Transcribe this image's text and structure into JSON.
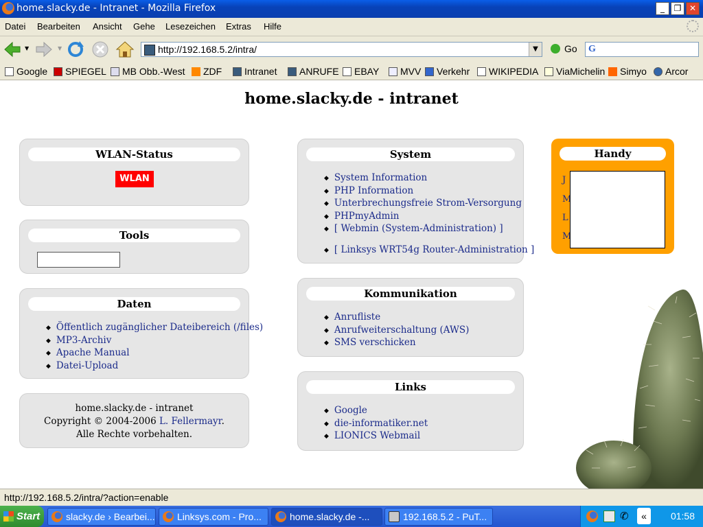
{
  "window": {
    "title": "home.slacky.de - Intranet - Mozilla Firefox",
    "minimize": "_",
    "maximize": "❐",
    "close": "✕"
  },
  "menu": [
    "Datei",
    "Bearbeiten",
    "Ansicht",
    "Gehe",
    "Lesezeichen",
    "Extras",
    "Hilfe"
  ],
  "nav": {
    "url": "http://192.168.5.2/intra/",
    "go_label": "Go",
    "search_value": ""
  },
  "bookmarks": [
    "Google",
    "SPIEGEL",
    "MB Obb.-West",
    "ZDF",
    "Intranet",
    "ANRUFE",
    "EBAY",
    "MVV",
    "Verkehr",
    "WIKIPEDIA",
    "ViaMichelin",
    "Simyo",
    "Arcor"
  ],
  "page": {
    "title": "home.slacky.de - intranet",
    "wlan": {
      "heading": "WLAN-Status",
      "button": "WLAN"
    },
    "tools": {
      "heading": "Tools",
      "input_value": ""
    },
    "daten": {
      "heading": "Daten",
      "items": [
        "Öffentlich zugänglicher Dateibereich (/files)",
        "MP3-Archiv",
        "Apache Manual",
        "Datei-Upload"
      ]
    },
    "footer": {
      "line1": "home.slacky.de - intranet",
      "line2_prefix": "Copyright © 2004-2006 ",
      "author": "L. Fellermayr",
      "line2_suffix": ".",
      "line3": "Alle Rechte vorbehalten."
    },
    "system": {
      "heading": "System",
      "items": [
        "System Information",
        "PHP Information",
        "Unterbrechungsfreie Strom-Versorgung",
        "PHPmyAdmin",
        "[ Webmin (System-Administration) ]",
        "[ Linksys WRT54g Router-Administration ]"
      ]
    },
    "kommunikation": {
      "heading": "Kommunikation",
      "items": [
        "Anrufliste",
        "Anrufweiterschaltung (AWS)",
        "SMS verschicken"
      ]
    },
    "links": {
      "heading": "Links",
      "items": [
        "Google",
        "die-informatiker.net",
        "LIONICS Webmail"
      ]
    },
    "handy": {
      "heading": "Handy",
      "labels": [
        "J",
        "M",
        "L",
        "M"
      ]
    }
  },
  "status": "http://192.168.5.2/intra/?action=enable",
  "taskbar": {
    "start": "Start",
    "tasks": [
      "slacky.de › Bearbei...",
      "Linksys.com - Pro...",
      "home.slacky.de -...",
      "192.168.5.2 - PuT..."
    ],
    "tray_arrow": "«",
    "clock": "01:58"
  },
  "colors": {
    "wlan": "#ff0000",
    "handy": "#ffa000",
    "link": "#1a2a8a",
    "box": "#e6e6e6"
  }
}
